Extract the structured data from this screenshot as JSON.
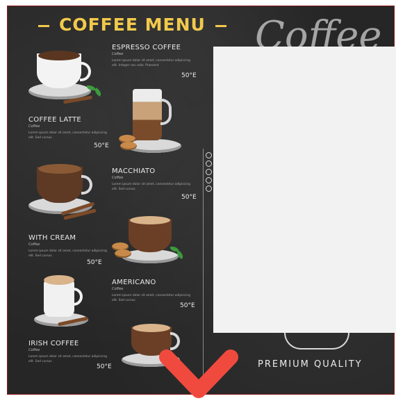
{
  "menu": {
    "title": "COFFEE MENU",
    "script_title": "Coffee",
    "premium": "PREMIUM QUALITY",
    "items": [
      {
        "name": "ESPRESSO COFFEE",
        "sub": "Coffee",
        "desc": "Lorem ipsum dolor sit amet, consectetur adipiscing elit. Integer nec odio. Praesent",
        "price": "50°E"
      },
      {
        "name": "COFFEE LATTE",
        "sub": "Coffee",
        "desc": "Lorem ipsum dolor sit amet, consectetur adipiscing elit. Sed cursus",
        "price": "50°E"
      },
      {
        "name": "MACCHIATO",
        "sub": "Coffee",
        "desc": "Lorem ipsum dolor sit amet, consectetur adipiscing elit. Sed cursus",
        "price": "50°E"
      },
      {
        "name": "WITH CREAM",
        "sub": "Coffee",
        "desc": "Lorem ipsum dolor sit amet, consectetur adipiscing elit. Sed cursus",
        "price": "50°E"
      },
      {
        "name": "AMERICANO",
        "sub": "Coffee",
        "desc": "Lorem ipsum dolor sit amet, consectetur adipiscing elit. Sed cursus",
        "price": "50°E"
      },
      {
        "name": "IRISH COFFEE",
        "sub": "Coffee",
        "desc": "Lorem ipsum dolor sit amet, consectetur adipiscing elit. Sed cursus",
        "price": "50°E"
      }
    ]
  },
  "colors": {
    "board": "#262626",
    "title": "#f2c94c",
    "chevron": "#f04a3e",
    "overlay": "#f2f2f2"
  },
  "icons": {
    "overlay_chevron": "chevron-down-icon"
  }
}
